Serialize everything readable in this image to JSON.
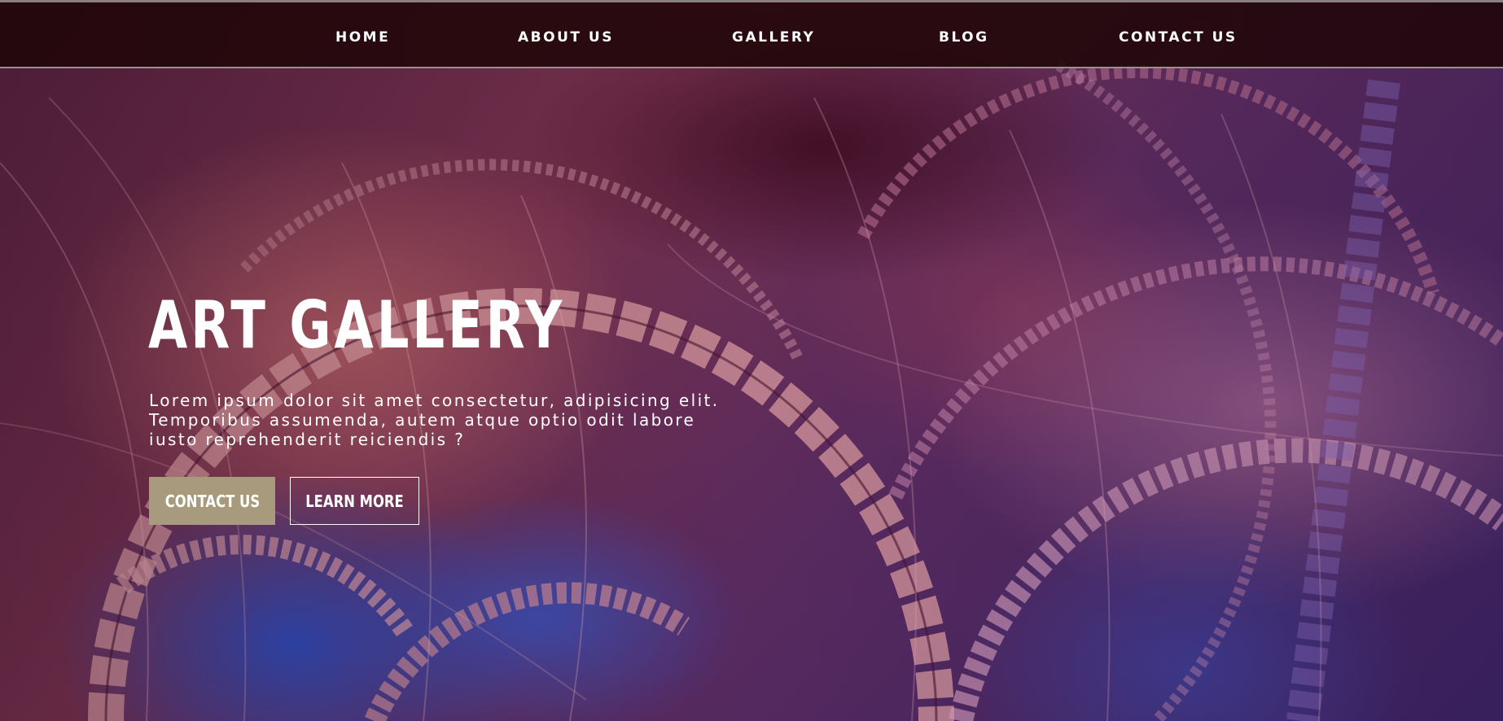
{
  "nav": {
    "items": [
      {
        "label": "HOME"
      },
      {
        "label": "ABOUT US"
      },
      {
        "label": "GALLERY"
      },
      {
        "label": "BLOG"
      },
      {
        "label": "CONTACT US"
      }
    ]
  },
  "hero": {
    "title": "ART GALLERY",
    "description": "Lorem ipsum dolor sit amet consectetur, adipisicing elit. Temporibus assumenda, autem atque optio odit labore iusto reprehenderit reiciendis ?",
    "buttons": {
      "contact": "CONTACT US",
      "learn_more": "LEARN MORE"
    }
  },
  "colors": {
    "nav_background": "#200608",
    "primary_button": "#a89a7c",
    "text": "#ffffff"
  }
}
